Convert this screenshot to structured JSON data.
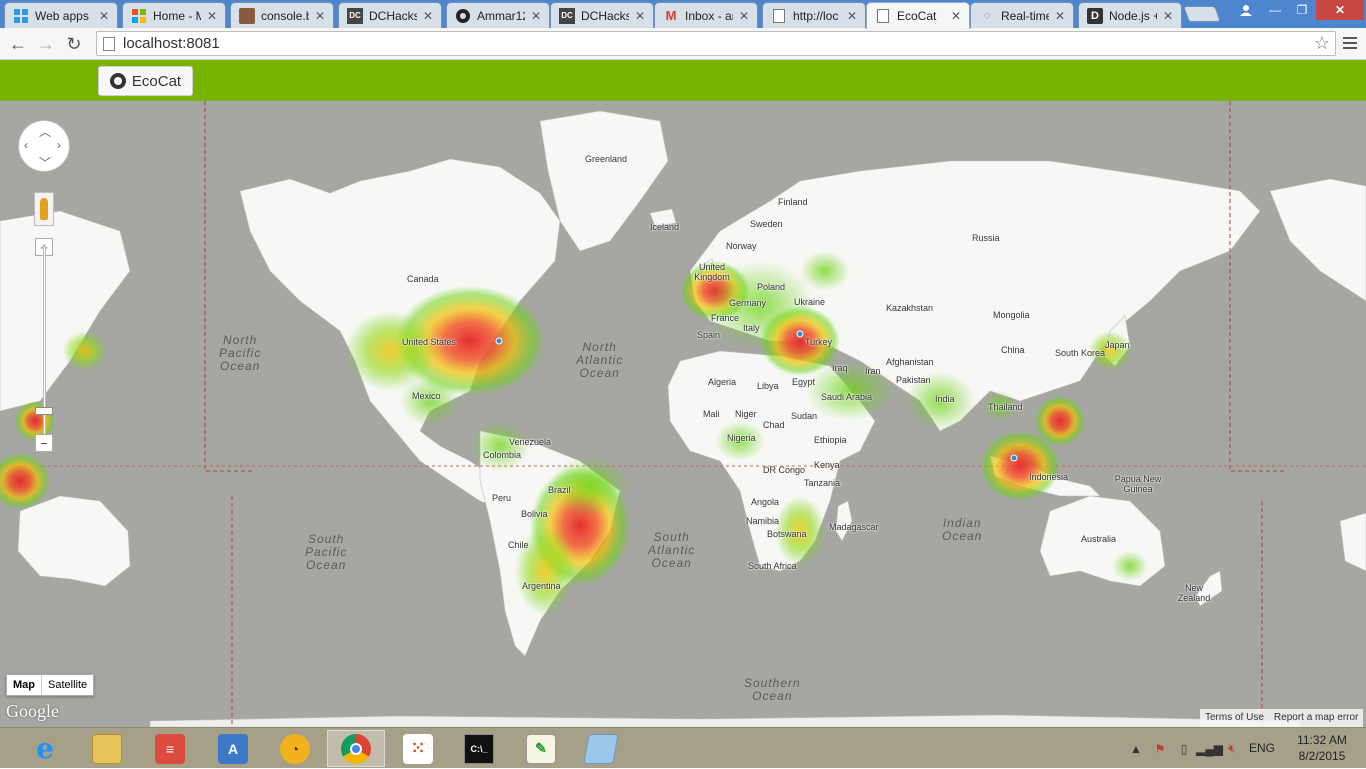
{
  "browser": {
    "tabs": [
      {
        "label": "Web apps",
        "icon": "windows-icon",
        "active": false
      },
      {
        "label": "Home - M",
        "icon": "windows-icon",
        "active": false
      },
      {
        "label": "console.b",
        "icon": "image-icon",
        "active": false
      },
      {
        "label": "DCHacks",
        "icon": "dc-icon",
        "active": false
      },
      {
        "label": "Ammar12",
        "icon": "github-icon",
        "active": false
      },
      {
        "label": "DCHacks",
        "icon": "dc-icon",
        "active": false
      },
      {
        "label": "Inbox - ar",
        "icon": "gmail-icon",
        "active": false
      },
      {
        "label": "http://loc",
        "icon": "page-icon",
        "active": false
      },
      {
        "label": "EcoCat",
        "icon": "page-icon",
        "active": true
      },
      {
        "label": "Real-time",
        "icon": "loading-icon",
        "active": false
      },
      {
        "label": "Node.js +",
        "icon": "d-icon",
        "active": false
      }
    ],
    "url": "localhost:8081"
  },
  "app": {
    "brand_button": "EcoCat",
    "brand_icon": "github-icon",
    "accent_color": "#77b300"
  },
  "map": {
    "map_type_options": [
      "Map",
      "Satellite"
    ],
    "selected_map_type": "Map",
    "logo": "Google",
    "footer_links": [
      "Terms of Use",
      "Report a map error"
    ],
    "zoom_in_label": "+",
    "zoom_out_label": "−",
    "place_labels": [
      "Greenland",
      "Iceland",
      "Finland",
      "Sweden",
      "Norway",
      "Russia",
      "United Kingdom",
      "Poland",
      "Germany",
      "Ukraine",
      "France",
      "Italy",
      "Spain",
      "Kazakhstan",
      "Mongolia",
      "Turkey",
      "China",
      "Afghanistan",
      "Iran",
      "Iraq",
      "Pakistan",
      "Egypt",
      "Saudi Arabia",
      "India",
      "Algeria",
      "Libya",
      "Mali",
      "Niger",
      "Chad",
      "Sudan",
      "Ethiopia",
      "Nigeria",
      "DR Congo",
      "Kenya",
      "Tanzania",
      "Angola",
      "Namibia",
      "Botswana",
      "South Africa",
      "Madagascar",
      "Thailand",
      "Indonesia",
      "Papua New Guinea",
      "Australia",
      "New Zealand",
      "South Korea",
      "Japan",
      "Canada",
      "United States",
      "Mexico",
      "Venezuela",
      "Colombia",
      "Brazil",
      "Peru",
      "Bolivia",
      "Chile",
      "Argentina"
    ],
    "ocean_labels": [
      "North\nPacific\nOcean",
      "North\nAtlantic\nOcean",
      "South\nPacific\nOcean",
      "South\nAtlantic\nOcean",
      "Indian\nOcean",
      "Southern\nOcean"
    ],
    "heat_colors": {
      "hot": "#e3252b",
      "warm": "#f2c200",
      "mild": "#6bd414"
    }
  },
  "taskbar": {
    "apps": [
      {
        "name": "internet-explorer",
        "active": false
      },
      {
        "name": "file-explorer",
        "active": false
      },
      {
        "name": "todoist",
        "active": false
      },
      {
        "name": "app-a",
        "active": false
      },
      {
        "name": "speed-gauge",
        "active": false
      },
      {
        "name": "chrome",
        "active": true
      },
      {
        "name": "apps-grid",
        "active": false
      },
      {
        "name": "command-prompt",
        "active": false
      },
      {
        "name": "notepad-plus",
        "active": false
      },
      {
        "name": "notes",
        "active": false
      }
    ],
    "language": "ENG",
    "time": "11:32 AM",
    "date": "8/2/2015"
  }
}
